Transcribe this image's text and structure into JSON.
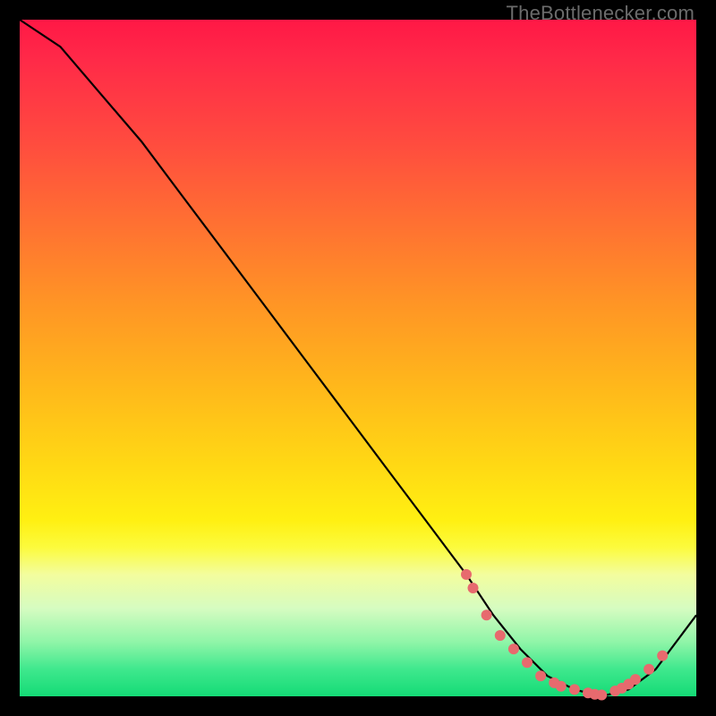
{
  "attribution": "TheBottlenecker.com",
  "colors": {
    "gradient_top": "#ff1846",
    "gradient_bottom": "#14db76",
    "line": "#000000",
    "marker": "#e76a6e",
    "page_bg": "#000000"
  },
  "chart_data": {
    "type": "line",
    "title": "",
    "xlabel": "",
    "ylabel": "",
    "xlim": [
      0,
      100
    ],
    "ylim": [
      0,
      100
    ],
    "x": [
      0,
      6,
      12,
      18,
      24,
      30,
      36,
      42,
      48,
      54,
      60,
      66,
      70,
      74,
      78,
      82,
      86,
      90,
      94,
      100
    ],
    "values": [
      100,
      96,
      89,
      82,
      74,
      66,
      58,
      50,
      42,
      34,
      26,
      18,
      12,
      7,
      3,
      1,
      0,
      1,
      4,
      12
    ],
    "markers_x": [
      66,
      67,
      69,
      71,
      73,
      75,
      77,
      79,
      80,
      82,
      84,
      85,
      86,
      88,
      89,
      90,
      91,
      93,
      95
    ],
    "markers_y": [
      18,
      16,
      12,
      9,
      7,
      5,
      3,
      2,
      1.5,
      1,
      0.5,
      0.3,
      0.2,
      0.8,
      1.2,
      1.8,
      2.5,
      4,
      6
    ],
    "marker_radius": 6
  }
}
